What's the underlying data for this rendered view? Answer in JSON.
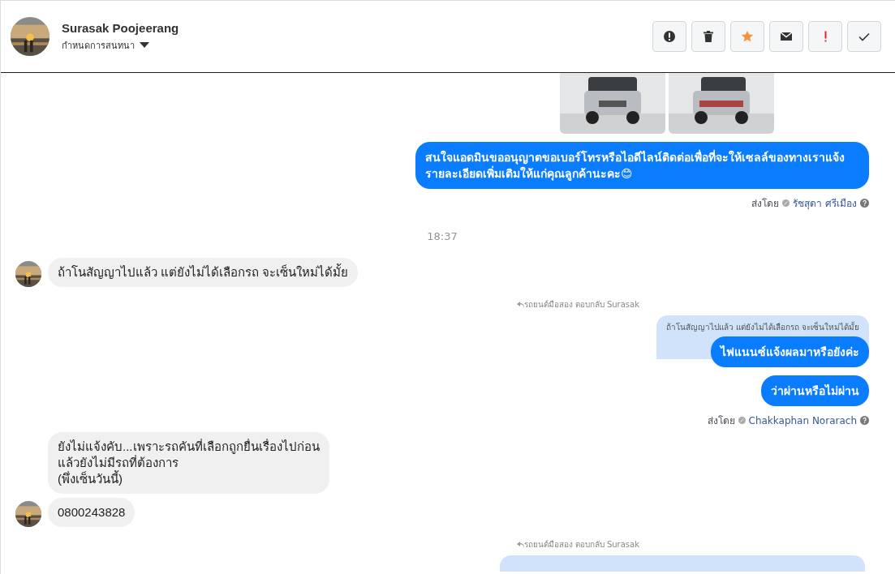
{
  "header": {
    "name": "Surasak Poojeerang",
    "subtitle": "กำหนดการสนทนา",
    "actions": [
      {
        "kind": "alert"
      },
      {
        "kind": "trash"
      },
      {
        "kind": "star"
      },
      {
        "kind": "mail"
      },
      {
        "kind": "important"
      },
      {
        "kind": "done"
      }
    ]
  },
  "messages": [
    {
      "kind": "images"
    },
    {
      "kind": "outgoing",
      "text": "สนใจแอดมินขออนุญาตขอเบอร์โทรหรือไอดีไลน์ติดต่อเพื่อที่จะให้เซลล์ของทางเราแจ้งรายละเอียดเพิ่มเติมให้แก่คุณลูกค้านะคะ😊"
    },
    {
      "kind": "sent_by",
      "label": "ส่งโดย",
      "name": "รัชสุดา ศรีเมือง"
    },
    {
      "kind": "time",
      "text": "18:37"
    },
    {
      "kind": "incoming",
      "avatar": true,
      "text": "ถ้าโนสัญญาไปแล้ว แต่ยังไม่ได้เลือกรถ  จะเซ็นใหม่ได้มั้ย"
    },
    {
      "kind": "reply_label",
      "text": "รถยนต์มือสอง ตอบกลับ Surasak"
    },
    {
      "kind": "quote",
      "text": "ถ้าโนสัญญาไปแล้ว แต่ยังไม่ได้เลือกรถ จะเซ็นใหม่ได้มั้ย"
    },
    {
      "kind": "outgoing",
      "text": "ไฟแนนซ์แจ้งผลมาหรือยังค่ะ"
    },
    {
      "kind": "outgoing",
      "text": "ว่าผ่านหรือไม่ผ่าน"
    },
    {
      "kind": "sent_by",
      "label": "ส่งโดย",
      "name": "Chakkaphan Norarach"
    },
    {
      "kind": "incoming",
      "avatar": false,
      "text": "ยังไม่แจ้งคับ...เพราะรถคันที่เลือกถูกยื่นเรื่องไปก่อน\nแล้วยังไม่มีรถที่ต้องการ\n(พึ่งเซ็นวันนี้)"
    },
    {
      "kind": "incoming",
      "avatar": true,
      "text": "0800243828"
    },
    {
      "kind": "reply_label",
      "text": "รถยนต์มือสอง ตอบกลับ Surasak"
    },
    {
      "kind": "quote_cut"
    }
  ]
}
